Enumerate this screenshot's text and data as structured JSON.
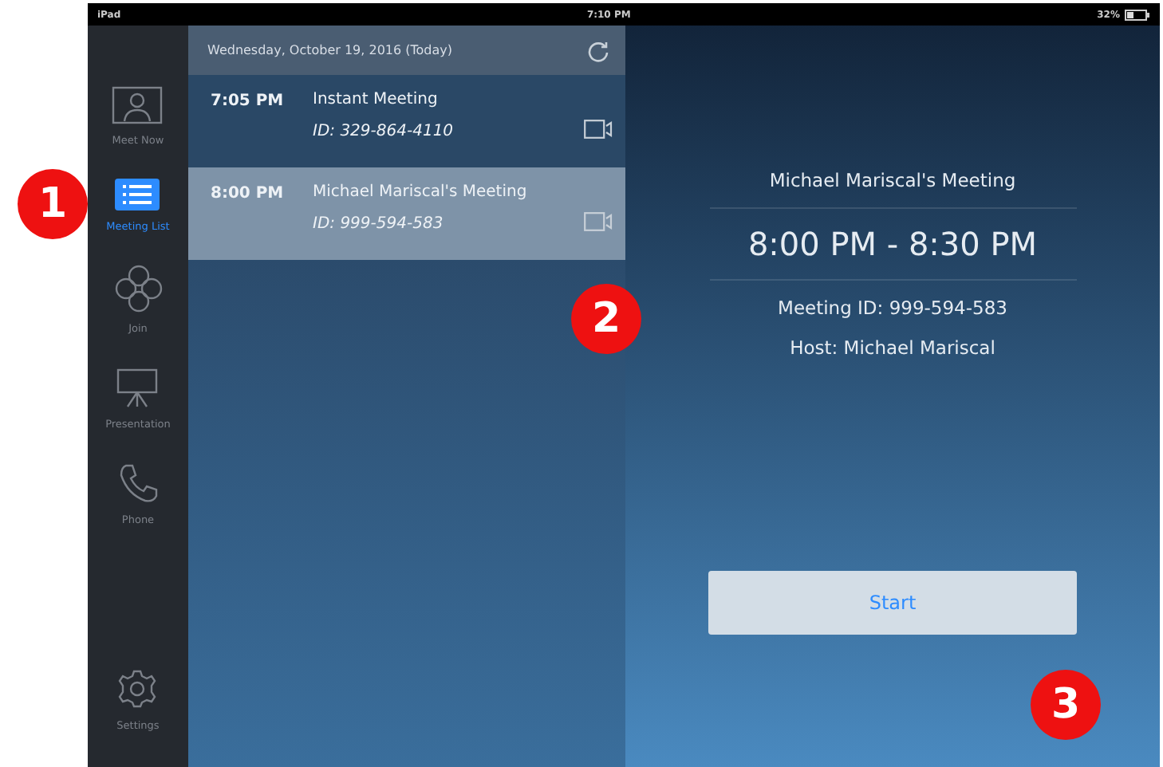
{
  "status_bar": {
    "device": "iPad",
    "time": "7:10 PM",
    "battery": "32%"
  },
  "sidebar": {
    "items": [
      {
        "label": "Meet Now",
        "selected": false
      },
      {
        "label": "Meeting List",
        "selected": true
      },
      {
        "label": "Join",
        "selected": false
      },
      {
        "label": "Presentation",
        "selected": false
      },
      {
        "label": "Phone",
        "selected": false
      }
    ],
    "bottom_item": {
      "label": "Settings",
      "selected": false
    }
  },
  "meeting_list": {
    "date_header": "Wednesday, October 19, 2016 (Today)",
    "meetings": [
      {
        "time": "7:05 PM",
        "title": "Instant Meeting",
        "id": "ID: 329-864-4110",
        "selected": false
      },
      {
        "time": "8:00 PM",
        "title": "Michael Mariscal's Meeting",
        "id": "ID: 999-594-583",
        "selected": true
      }
    ]
  },
  "details": {
    "title": "Michael Mariscal's Meeting",
    "time_range": "8:00 PM - 8:30 PM",
    "meeting_id": "Meeting ID: 999-594-583",
    "host": "Host: Michael Mariscal",
    "button": "Start"
  },
  "callouts": [
    "1",
    "2",
    "3"
  ]
}
